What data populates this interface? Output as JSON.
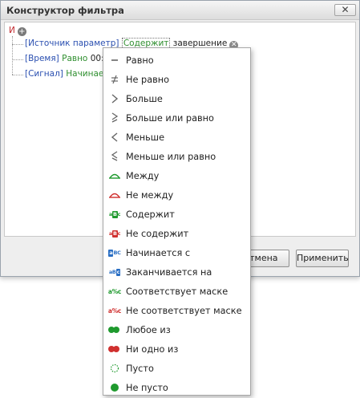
{
  "window": {
    "title": "Конструктор фильтра",
    "close_label": "✕"
  },
  "filter": {
    "group_operator": "И",
    "conditions": [
      {
        "field": "[Источник параметр]",
        "operator": "Содержит",
        "value": "завершение"
      },
      {
        "field": "[Время]",
        "operator": "Равно",
        "value": "00:00:0"
      },
      {
        "field": "[Сигнал]",
        "operator": "Начинается",
        "value": ""
      }
    ]
  },
  "buttons": {
    "cancel": "Отмена",
    "apply": "Применить"
  },
  "operator_menu": {
    "items": [
      {
        "label": "Равно",
        "icon": "equals-icon"
      },
      {
        "label": "Не равно",
        "icon": "not-equal-icon"
      },
      {
        "label": "Больше",
        "icon": "greater-icon"
      },
      {
        "label": "Больше или равно",
        "icon": "greater-or-equal-icon"
      },
      {
        "label": "Меньше",
        "icon": "less-icon"
      },
      {
        "label": "Меньше или равно",
        "icon": "less-or-equal-icon"
      },
      {
        "label": "Между",
        "icon": "between-icon"
      },
      {
        "label": "Не между",
        "icon": "not-between-icon"
      },
      {
        "label": "Содержит",
        "icon": "contains-icon",
        "glyph_a": "a",
        "glyph_b": "B",
        "glyph_c": "c"
      },
      {
        "label": "Не содержит",
        "icon": "not-contains-icon",
        "glyph_a": "a",
        "glyph_b": "B",
        "glyph_c": "c"
      },
      {
        "label": "Начинается с",
        "icon": "begins-with-icon",
        "glyph_a": "a",
        "glyph_b": "BC"
      },
      {
        "label": "Заканчивается на",
        "icon": "ends-with-icon",
        "glyph_a": "aB",
        "glyph_b": "c"
      },
      {
        "label": "Соответствует маске",
        "icon": "like-icon",
        "glyph_a": "a",
        "glyph_b": "%",
        "glyph_c": "c"
      },
      {
        "label": "Не соответствует маске",
        "icon": "not-like-icon",
        "glyph_a": "a",
        "glyph_b": "%",
        "glyph_c": "c"
      },
      {
        "label": "Любое из",
        "icon": "any-of-icon"
      },
      {
        "label": "Ни одно из",
        "icon": "none-of-icon"
      },
      {
        "label": "Пусто",
        "icon": "is-empty-icon"
      },
      {
        "label": "Не пусто",
        "icon": "is-not-empty-icon"
      }
    ]
  },
  "colors": {
    "group_operator": "#c0282d",
    "field": "#2a4fb0",
    "operator": "#2f8f2f",
    "icon_green": "#1f9a2e",
    "icon_red": "#d0302f",
    "icon_blue": "#2a6fc4"
  }
}
